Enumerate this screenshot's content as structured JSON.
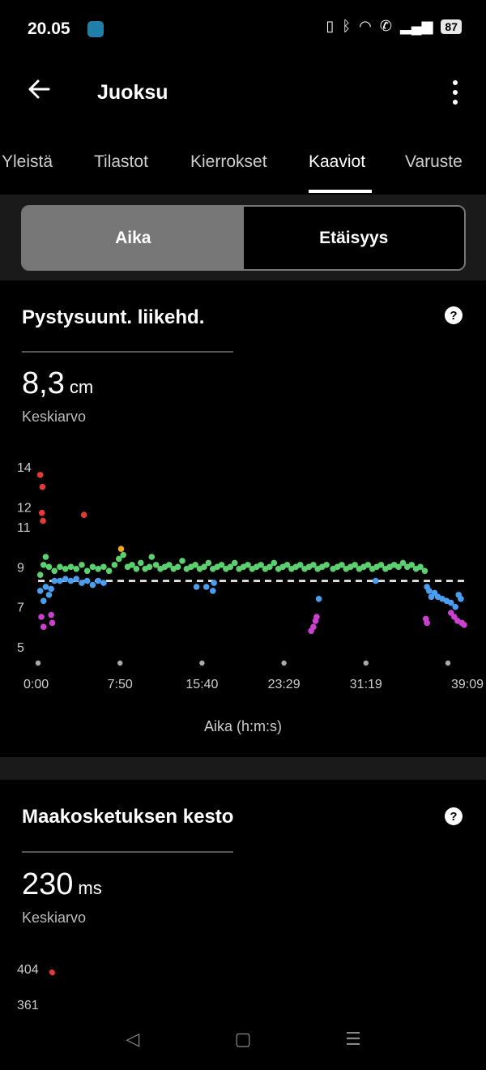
{
  "status": {
    "time": "20.05",
    "battery": "87"
  },
  "appbar": {
    "title": "Juoksu"
  },
  "tabs": [
    {
      "label": "Yleistä"
    },
    {
      "label": "Tilastot"
    },
    {
      "label": "Kierrokset"
    },
    {
      "label": "Kaaviot",
      "active": true
    },
    {
      "label": "Varuste"
    }
  ],
  "segmented": {
    "options": [
      "Aika",
      "Etäisyys"
    ],
    "selected": "Aika"
  },
  "vertical_oscillation": {
    "title": "Pystysuunt. liikehd.",
    "value": "8,3",
    "unit": "cm",
    "value_label": "Keskiarvo"
  },
  "ground_contact": {
    "title": "Maakosketuksen kesto",
    "value": "230",
    "unit": "ms",
    "value_label": "Keskiarvo"
  },
  "colors": {
    "red": "#e53935",
    "orange": "#f5a623",
    "green": "#5bd06e",
    "blue": "#4a9ef0",
    "purple": "#cc3fd1",
    "background": "#000000",
    "band": "#1a1a1a"
  },
  "chart_data": [
    {
      "type": "scatter",
      "title": "Pystysuunt. liikehd.",
      "xlabel": "Aika (h:m:s)",
      "ylabel": "",
      "x_ticks": [
        "0:00",
        "7:50",
        "15:40",
        "23:29",
        "31:19",
        "39:09"
      ],
      "y_ticks": [
        "14",
        "12",
        "11",
        "9",
        "7",
        "5"
      ],
      "xlim": [
        0,
        39.15
      ],
      "ylim": [
        5,
        14
      ],
      "average": 8.3,
      "series": [
        {
          "color": "red",
          "points": [
            [
              0.2,
              13.6
            ],
            [
              0.4,
              13.0
            ],
            [
              0.35,
              11.7
            ],
            [
              0.45,
              11.3
            ],
            [
              4.2,
              11.6
            ]
          ]
        },
        {
          "color": "orange",
          "points": [
            [
              7.6,
              9.9
            ]
          ]
        },
        {
          "color": "green",
          "points": [
            [
              0.2,
              8.6
            ],
            [
              0.5,
              9.1
            ],
            [
              0.7,
              9.5
            ],
            [
              1.0,
              9.0
            ],
            [
              1.5,
              8.8
            ],
            [
              2.0,
              9.0
            ],
            [
              2.5,
              8.9
            ],
            [
              3.0,
              9.0
            ],
            [
              3.5,
              8.9
            ],
            [
              4.0,
              9.1
            ],
            [
              4.5,
              8.8
            ],
            [
              5.0,
              9.0
            ],
            [
              5.5,
              8.9
            ],
            [
              6.0,
              9.0
            ],
            [
              6.5,
              8.8
            ],
            [
              7.0,
              9.1
            ],
            [
              7.4,
              9.4
            ],
            [
              7.8,
              9.6
            ],
            [
              8.2,
              9.0
            ],
            [
              8.6,
              9.1
            ],
            [
              9.0,
              8.9
            ],
            [
              9.4,
              9.2
            ],
            [
              9.8,
              8.9
            ],
            [
              10.2,
              9.0
            ],
            [
              10.4,
              9.5
            ],
            [
              10.8,
              9.1
            ],
            [
              11.2,
              8.9
            ],
            [
              11.6,
              9.0
            ],
            [
              12.0,
              9.1
            ],
            [
              12.4,
              8.9
            ],
            [
              12.8,
              9.0
            ],
            [
              13.2,
              9.3
            ],
            [
              13.6,
              8.9
            ],
            [
              14.0,
              9.0
            ],
            [
              14.4,
              9.1
            ],
            [
              14.8,
              8.9
            ],
            [
              15.2,
              9.0
            ],
            [
              15.6,
              9.2
            ],
            [
              16.0,
              8.9
            ],
            [
              16.4,
              9.0
            ],
            [
              16.8,
              9.1
            ],
            [
              17.2,
              8.9
            ],
            [
              17.6,
              9.0
            ],
            [
              18.0,
              9.2
            ],
            [
              18.4,
              8.9
            ],
            [
              18.8,
              9.0
            ],
            [
              19.2,
              9.1
            ],
            [
              19.6,
              8.9
            ],
            [
              20.0,
              9.0
            ],
            [
              20.4,
              9.1
            ],
            [
              20.8,
              8.9
            ],
            [
              21.2,
              9.0
            ],
            [
              21.6,
              9.2
            ],
            [
              22.0,
              8.9
            ],
            [
              22.4,
              9.0
            ],
            [
              22.8,
              9.1
            ],
            [
              23.2,
              8.9
            ],
            [
              23.6,
              9.0
            ],
            [
              24.0,
              9.1
            ],
            [
              24.4,
              8.9
            ],
            [
              24.8,
              9.0
            ],
            [
              25.2,
              9.1
            ],
            [
              25.6,
              8.9
            ],
            [
              26.0,
              9.0
            ],
            [
              26.4,
              9.1
            ],
            [
              27.0,
              8.9
            ],
            [
              27.4,
              9.0
            ],
            [
              27.8,
              9.1
            ],
            [
              28.2,
              8.9
            ],
            [
              28.6,
              9.0
            ],
            [
              29.0,
              9.1
            ],
            [
              29.4,
              8.9
            ],
            [
              29.8,
              9.0
            ],
            [
              30.2,
              9.1
            ],
            [
              30.6,
              8.9
            ],
            [
              31.0,
              9.0
            ],
            [
              31.4,
              9.1
            ],
            [
              31.8,
              8.9
            ],
            [
              32.2,
              9.0
            ],
            [
              32.6,
              9.1
            ],
            [
              33.0,
              9.0
            ],
            [
              33.4,
              9.2
            ],
            [
              33.8,
              9.0
            ],
            [
              34.2,
              9.1
            ],
            [
              34.6,
              8.9
            ],
            [
              35.0,
              9.0
            ],
            [
              35.4,
              8.8
            ]
          ]
        },
        {
          "color": "blue",
          "points": [
            [
              0.2,
              7.8
            ],
            [
              0.5,
              7.3
            ],
            [
              0.7,
              8.0
            ],
            [
              1.0,
              7.6
            ],
            [
              1.2,
              7.9
            ],
            [
              1.5,
              8.3
            ],
            [
              2.0,
              8.3
            ],
            [
              2.5,
              8.4
            ],
            [
              3.0,
              8.3
            ],
            [
              3.5,
              8.4
            ],
            [
              4.0,
              8.2
            ],
            [
              4.5,
              8.3
            ],
            [
              5.0,
              8.1
            ],
            [
              5.5,
              8.3
            ],
            [
              6.0,
              8.2
            ],
            [
              14.5,
              8.0
            ],
            [
              15.4,
              8.0
            ],
            [
              16.0,
              7.8
            ],
            [
              16.1,
              8.2
            ],
            [
              25.7,
              7.4
            ],
            [
              30.9,
              8.3
            ],
            [
              35.6,
              8.0
            ],
            [
              35.8,
              7.8
            ],
            [
              36.0,
              7.5
            ],
            [
              36.3,
              7.7
            ],
            [
              36.6,
              7.5
            ],
            [
              37.0,
              7.4
            ],
            [
              37.4,
              7.3
            ],
            [
              37.8,
              7.2
            ],
            [
              38.2,
              7.0
            ],
            [
              38.5,
              7.6
            ],
            [
              38.7,
              7.4
            ]
          ]
        },
        {
          "color": "purple",
          "points": [
            [
              0.3,
              6.5
            ],
            [
              0.5,
              6.0
            ],
            [
              1.2,
              6.6
            ],
            [
              1.3,
              6.2
            ],
            [
              25.0,
              5.8
            ],
            [
              25.2,
              6.0
            ],
            [
              25.4,
              6.3
            ],
            [
              25.5,
              6.5
            ],
            [
              35.5,
              6.4
            ],
            [
              35.6,
              6.2
            ],
            [
              37.8,
              6.7
            ],
            [
              38.1,
              6.5
            ],
            [
              38.4,
              6.3
            ],
            [
              38.8,
              6.2
            ],
            [
              39.0,
              6.1
            ]
          ]
        }
      ]
    },
    {
      "type": "scatter",
      "title": "Maakosketuksen kesto",
      "y_ticks": [
        "404",
        "361"
      ],
      "series": [
        {
          "color": "red",
          "points": [
            [
              0.5,
              400
            ],
            [
              0.7,
              399
            ]
          ]
        }
      ]
    }
  ]
}
